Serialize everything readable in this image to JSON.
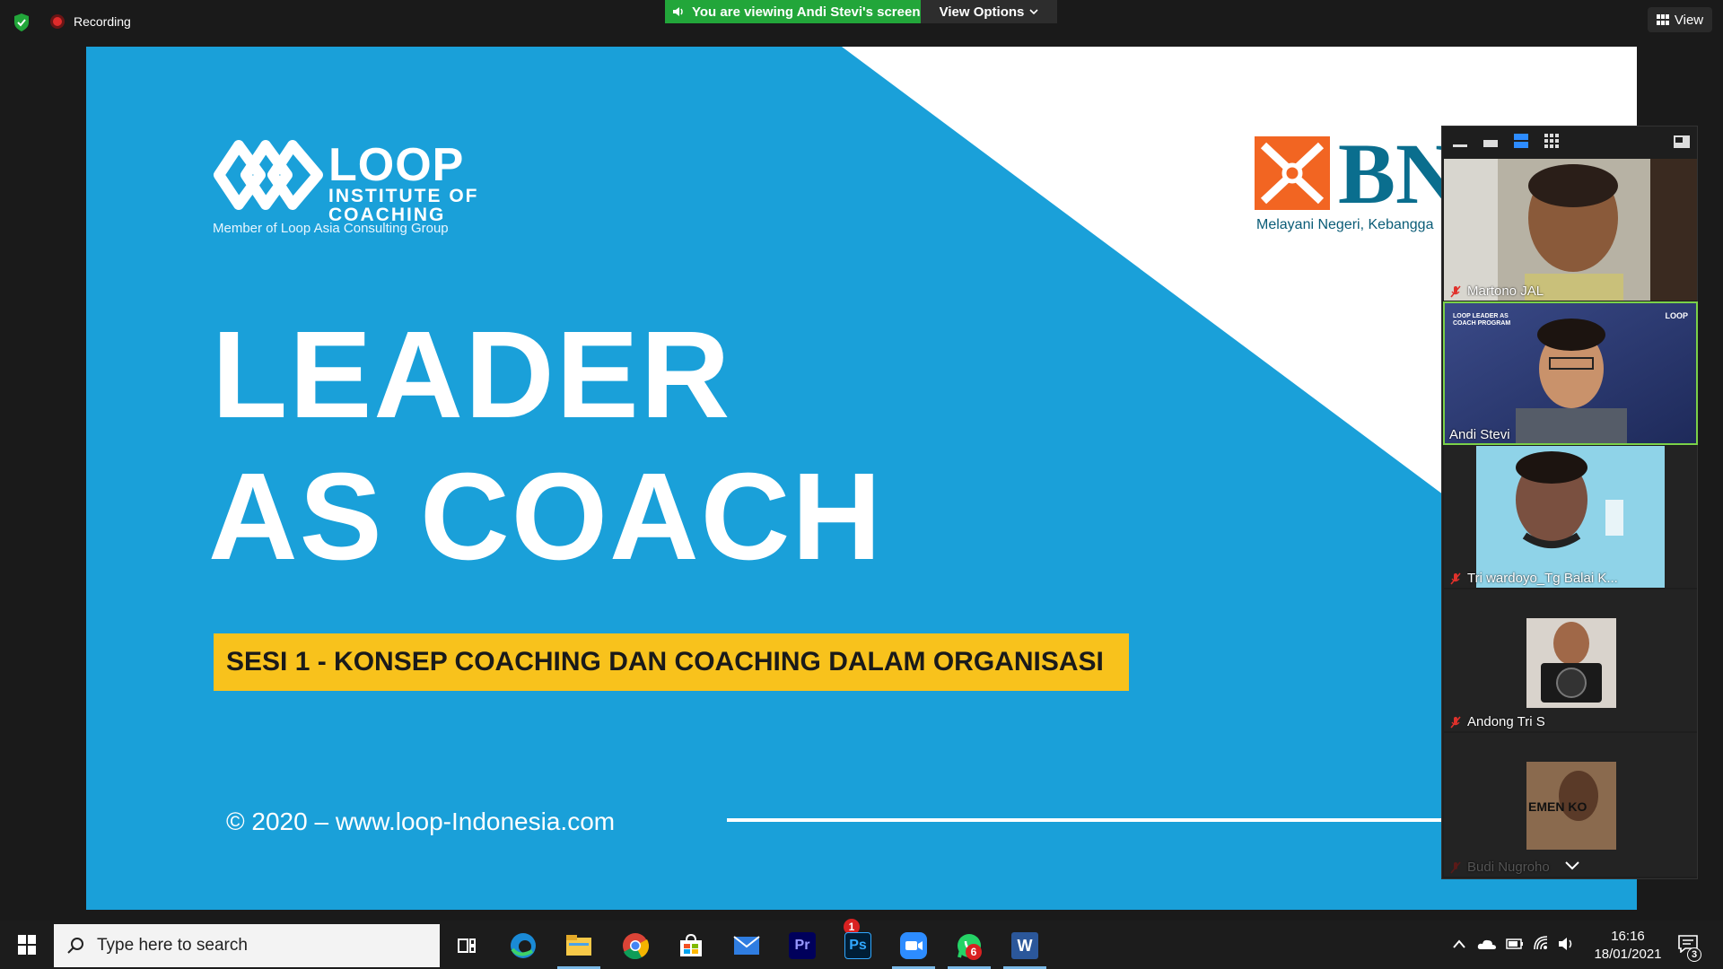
{
  "zoom": {
    "recording_label": "Recording",
    "viewing_banner": "You are viewing Andi Stevi's screen",
    "view_options_label": "View Options",
    "view_label": "View"
  },
  "slide": {
    "logo_main": "LOOP",
    "logo_sub1": "INSTITUTE OF",
    "logo_sub2": "COACHING",
    "logo_member": "Member of Loop Asia Consulting Group",
    "bni_text": "BN",
    "bni_tagline": "Melayani Negeri, Kebangga",
    "title_line1": "LEADER",
    "title_line2": "AS COACH",
    "session": "SESI 1 - KONSEP COACHING DAN COACHING DALAM ORGANISASI",
    "copyright": "© 2020 – www.loop-Indonesia.com",
    "colors": {
      "bg": "#1aa0d9",
      "band": "#f8c21c",
      "bni_red": "#f26522",
      "bni_teal": "#0a6e8e"
    }
  },
  "gallery": {
    "participants": [
      {
        "name": "Martono JAL",
        "muted": true
      },
      {
        "name": "Andi Stevi",
        "muted": false,
        "active": true
      },
      {
        "name": "Tri wardoyo_Tg Balai K...",
        "muted": true
      },
      {
        "name": "Andong Tri S",
        "muted": true
      },
      {
        "name": "Budi Nugroho",
        "muted": true
      }
    ],
    "thumb_caption": "LOOP LEADER AS COACH PROGRAM",
    "thumb_logo": "LOOP",
    "banner_text": "EMEN KO"
  },
  "taskbar": {
    "search_placeholder": "Type here to search",
    "apps": [
      "task-view",
      "edge",
      "file-explorer",
      "chrome",
      "store",
      "mail",
      "premiere",
      "photoshop",
      "zoom",
      "whatsapp",
      "word"
    ],
    "mail_badge": "1",
    "whatsapp_badge": "6",
    "time": "16:16",
    "date": "18/01/2021",
    "notification_count": "3",
    "premiere_label": "Pr",
    "photoshop_label": "Ps",
    "word_label": "W"
  }
}
